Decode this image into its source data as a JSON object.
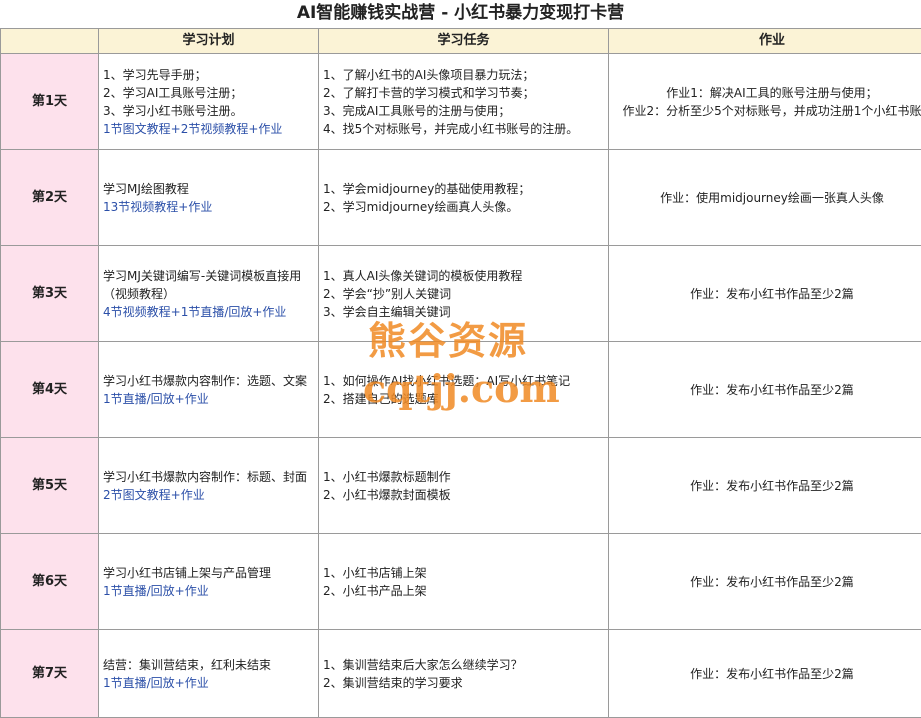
{
  "title": "AI智能赚钱实战营 - 小红书暴力变现打卡营",
  "headers": {
    "plan": "学习计划",
    "task": "学习任务",
    "homework": "作业"
  },
  "rows": [
    {
      "day": "第1天",
      "plan": [
        "1、学习先导手册；",
        "2、学习AI工具账号注册；",
        "3、学习小红书账号注册。"
      ],
      "plan_course": "1节图文教程+2节视频教程+作业",
      "tasks": [
        "1、了解小红书的AI头像项目暴力玩法；",
        "2、了解打卡营的学习模式和学习节奏；",
        "3、完成AI工具账号的注册与使用；",
        "4、找5个对标账号，并完成小红书账号的注册。"
      ],
      "homework": [
        "作业1：解决AI工具的账号注册与使用；",
        "作业2：分析至少5个对标账号，并成功注册1个小红书账"
      ]
    },
    {
      "day": "第2天",
      "plan": [
        "学习MJ绘图教程"
      ],
      "plan_course": "13节视频教程+作业",
      "tasks": [
        "1、学会midjourney的基础使用教程；",
        "2、学习midjourney绘画真人头像。"
      ],
      "homework": [
        "作业：使用midjourney绘画一张真人头像"
      ]
    },
    {
      "day": "第3天",
      "plan": [
        "学习MJ关键词编写-关键词模板直接用（视频教程）"
      ],
      "plan_course": "4节视频教程+1节直播/回放+作业",
      "tasks": [
        "1、真人AI头像关键词的模板使用教程",
        "2、学会“抄”别人关键词",
        "3、学会自主编辑关键词"
      ],
      "homework": [
        "作业：发布小红书作品至少2篇"
      ]
    },
    {
      "day": "第4天",
      "plan": [
        "学习小红书爆款内容制作：选题、文案"
      ],
      "plan_course": "1节直播/回放+作业",
      "tasks": [
        "1、如何操作AI找小红书选题；AI写小红书笔记",
        "2、搭建自己的选题库"
      ],
      "homework": [
        "作业：发布小红书作品至少2篇"
      ]
    },
    {
      "day": "第5天",
      "plan": [
        "学习小红书爆款内容制作：标题、封面"
      ],
      "plan_course": "2节图文教程+作业",
      "tasks": [
        "1、小红书爆款标题制作",
        "2、小红书爆款封面模板"
      ],
      "homework": [
        "作业：发布小红书作品至少2篇"
      ]
    },
    {
      "day": "第6天",
      "plan": [
        "学习小红书店铺上架与产品管理"
      ],
      "plan_course": "1节直播/回放+作业",
      "tasks": [
        "1、小红书店铺上架",
        "2、小红书产品上架"
      ],
      "homework": [
        "作业：发布小红书作品至少2篇"
      ]
    },
    {
      "day": "第7天",
      "plan": [
        "结营：集训营结束，红利未结束"
      ],
      "plan_course": "1节直播/回放+作业",
      "tasks": [
        "1、集训营结束后大家怎么继续学习？",
        "2、集训营结束的学习要求"
      ],
      "homework": [
        "作业：发布小红书作品至少2篇"
      ]
    }
  ],
  "watermark": {
    "line1": "熊谷资源",
    "line2": "cqtjj.com"
  },
  "colors": {
    "header_bg": "#fbf3d6",
    "day_bg": "#fde1ec",
    "course_text": "#2b4fa8",
    "watermark": "#f08a24"
  }
}
